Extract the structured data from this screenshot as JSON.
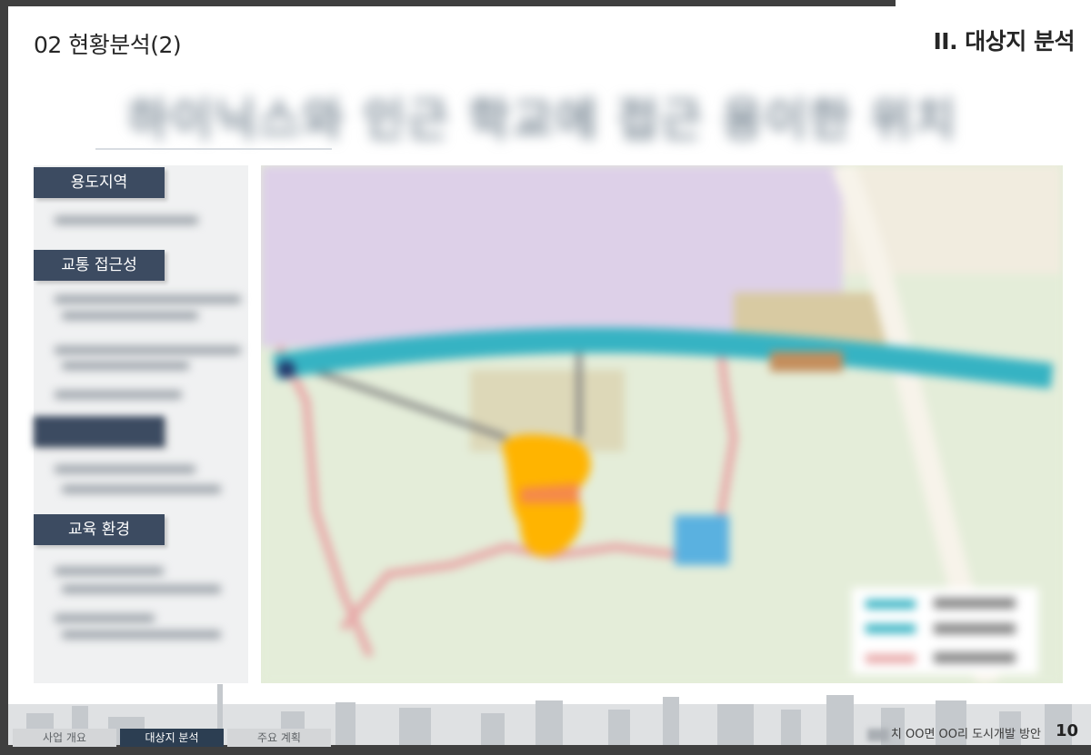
{
  "header": {
    "page_title": "02 현황분석(2)",
    "section_title": "II. 대상지 분석",
    "headline": "하이닉스와 인근 학교에 접근 용이한 위치"
  },
  "sidebar": {
    "tags": [
      "용도지역",
      "교통 접근성",
      "",
      "교육 환경"
    ]
  },
  "map": {
    "colors": {
      "zone": "#ddd0e8",
      "land": "#e4edd9",
      "road_main": "#36b3c3",
      "road_secondary": "#e8a8a8",
      "site_orange": "#ffb400",
      "site_blue": "#5ab1e0",
      "urban": "#d8caa2"
    }
  },
  "footer": {
    "tabs": [
      "사업 개요",
      "대상지 분석",
      "주요 계획"
    ],
    "active_tab": "대상지 분석",
    "project_label": "치 OO면 OO리 도시개발 방안",
    "page_number": "10"
  },
  "colors": {
    "frame": "#3f3f3f",
    "tag_bg": "#3c4b61",
    "tab_active": "#2c3e52"
  }
}
